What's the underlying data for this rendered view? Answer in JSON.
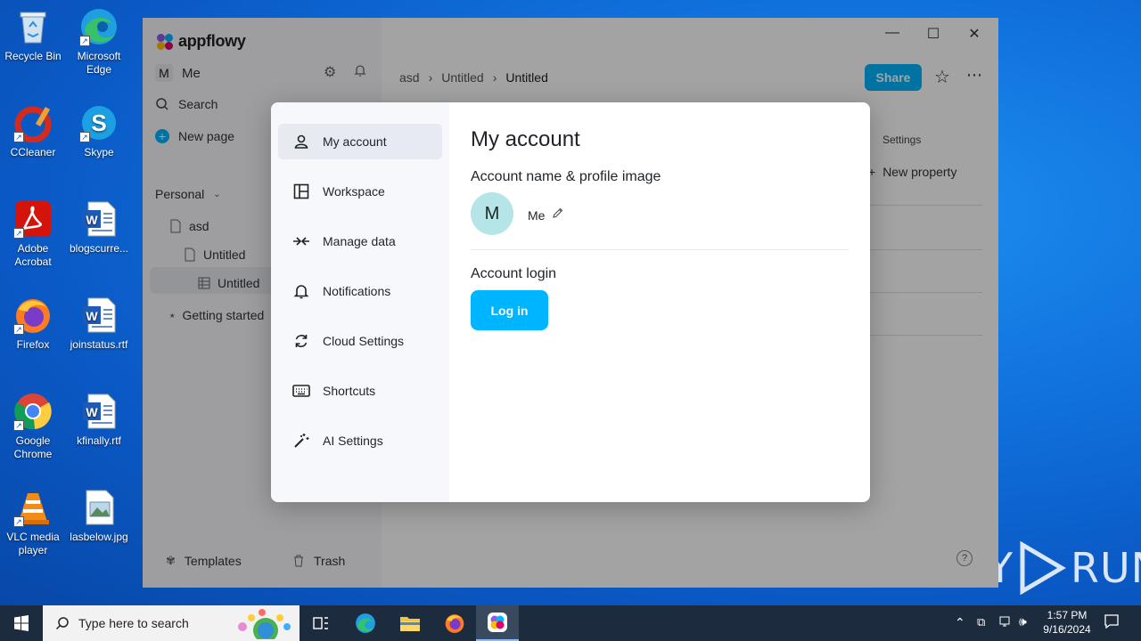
{
  "desktop": {
    "icons": [
      {
        "label": "Recycle Bin"
      },
      {
        "label": "Microsoft Edge"
      },
      {
        "label": "CCleaner"
      },
      {
        "label": "Skype"
      },
      {
        "label": "Adobe Acrobat"
      },
      {
        "label": "blogscurre..."
      },
      {
        "label": "Firefox"
      },
      {
        "label": "joinstatus.rtf"
      },
      {
        "label": "Google Chrome"
      },
      {
        "label": "kfinally.rtf"
      },
      {
        "label": "VLC media player"
      },
      {
        "label": "lasbelow.jpg"
      }
    ]
  },
  "app": {
    "brand": "appflowy",
    "user_initial": "M",
    "user_name": "Me",
    "search_label": "Search",
    "new_page_label": "New page",
    "section_label": "Personal",
    "tree": [
      {
        "label": "asd"
      },
      {
        "label": "Untitled"
      },
      {
        "label": "Untitled"
      },
      {
        "label": "Getting started"
      }
    ],
    "templates_label": "Templates",
    "trash_label": "Trash",
    "breadcrumb": [
      "asd",
      "Untitled",
      "Untitled"
    ],
    "share_label": "Share",
    "settings_label": "Settings",
    "new_property_label": "New property"
  },
  "modal": {
    "nav": [
      {
        "label": "My account",
        "icon": "person-icon"
      },
      {
        "label": "Workspace",
        "icon": "workspace-icon"
      },
      {
        "label": "Manage data",
        "icon": "arrows-in-icon"
      },
      {
        "label": "Notifications",
        "icon": "bell-icon"
      },
      {
        "label": "Cloud Settings",
        "icon": "sync-icon"
      },
      {
        "label": "Shortcuts",
        "icon": "keyboard-icon"
      },
      {
        "label": "AI Settings",
        "icon": "magic-wand-icon"
      }
    ],
    "title": "My account",
    "profile_heading": "Account name & profile image",
    "avatar_initial": "M",
    "account_name": "Me",
    "login_heading": "Account login",
    "login_button": "Log in"
  },
  "taskbar": {
    "search_placeholder": "Type here to search",
    "time": "1:57 PM",
    "date": "9/16/2024"
  },
  "watermark": {
    "left": "ANY",
    "right": "RUN"
  },
  "colors": {
    "accent": "#00b5ff",
    "avatar_bg": "#b5e5e7"
  }
}
